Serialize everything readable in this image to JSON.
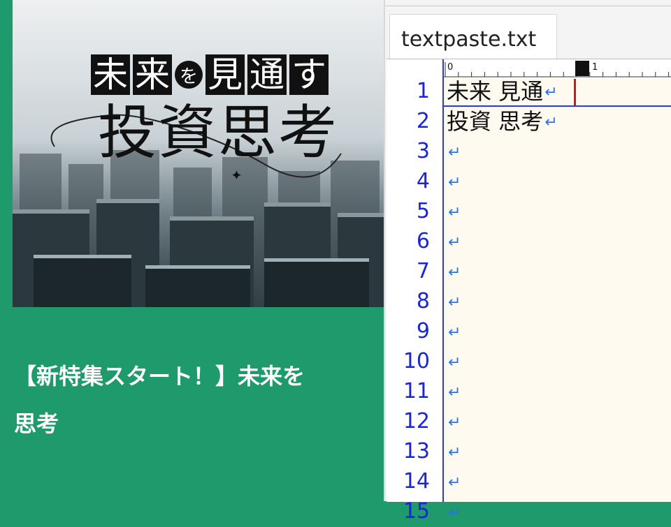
{
  "article": {
    "hero_title_chars": [
      "未",
      "来",
      "を",
      "見",
      "通",
      "す"
    ],
    "hero_subtitle": "投資思考",
    "headline_line1": "【新特集スタート！】未来を",
    "headline_line2": "思考"
  },
  "editor": {
    "tab_title": "textpaste.txt",
    "ruler_labels": [
      "0",
      "1"
    ],
    "eol_symbol": "↵",
    "lines": [
      {
        "num": "1",
        "text": "未来 見通"
      },
      {
        "num": "2",
        "text": "投資 思考"
      },
      {
        "num": "3",
        "text": ""
      },
      {
        "num": "4",
        "text": ""
      },
      {
        "num": "5",
        "text": ""
      },
      {
        "num": "6",
        "text": ""
      },
      {
        "num": "7",
        "text": ""
      },
      {
        "num": "8",
        "text": ""
      },
      {
        "num": "9",
        "text": ""
      },
      {
        "num": "10",
        "text": ""
      },
      {
        "num": "11",
        "text": ""
      },
      {
        "num": "12",
        "text": ""
      },
      {
        "num": "13",
        "text": ""
      },
      {
        "num": "14",
        "text": ""
      },
      {
        "num": "15",
        "text": ""
      }
    ]
  },
  "colors": {
    "page_green": "#1e9a6d",
    "line_number_blue": "#1a24d8",
    "eol_blue": "#2a72e8",
    "caret_red": "#e01010",
    "editor_background": "#fffaf0"
  }
}
